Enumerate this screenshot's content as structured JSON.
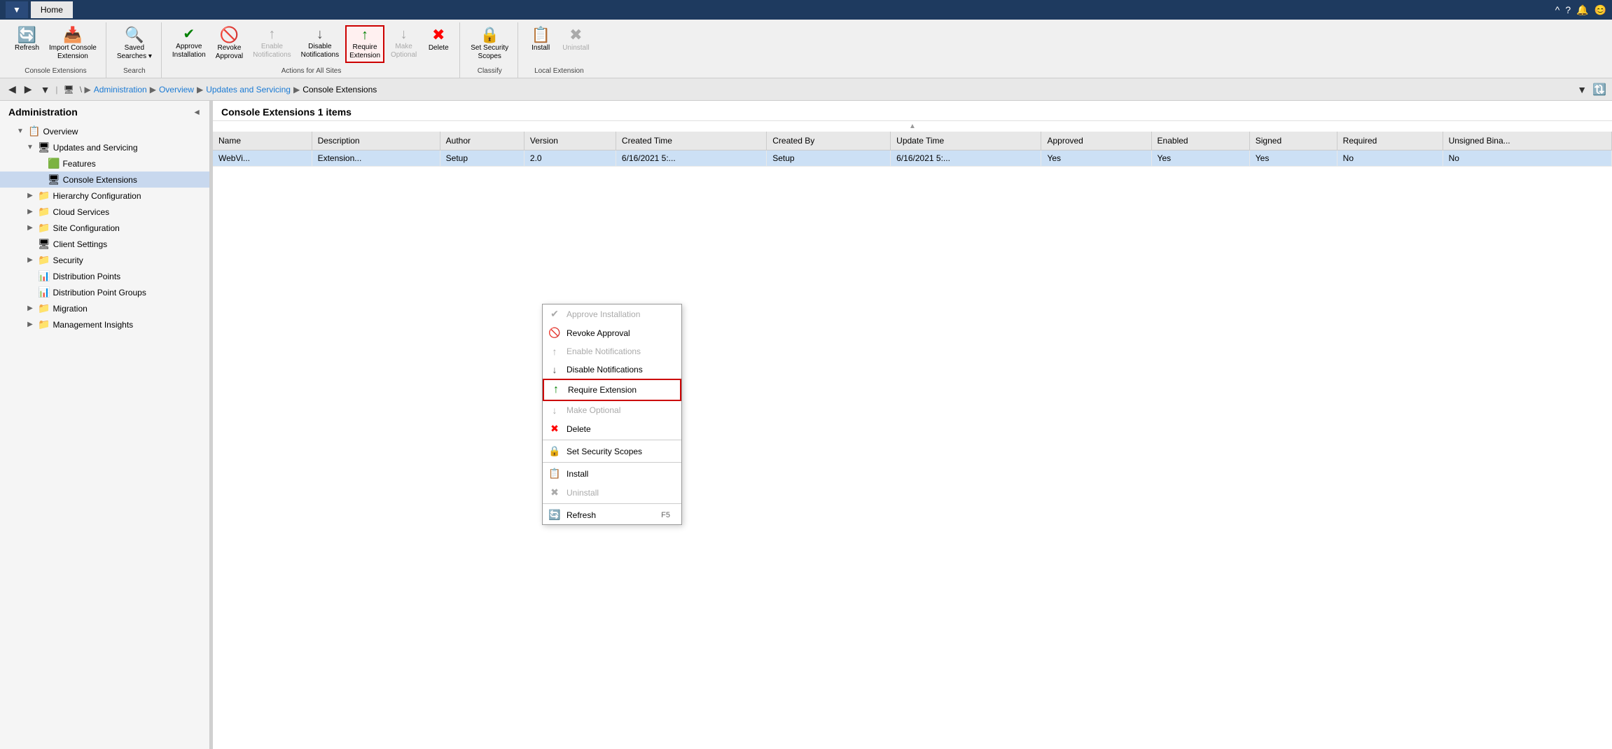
{
  "titlebar": {
    "btn_label": "▼",
    "tab_home": "Home",
    "icons": [
      "^",
      "?",
      "🔔",
      "😊"
    ]
  },
  "ribbon": {
    "groups": [
      {
        "label": "Console Extensions",
        "buttons": [
          {
            "id": "refresh",
            "label": "Refresh",
            "icon": "🔄",
            "disabled": false,
            "highlighted": false
          },
          {
            "id": "import-console-extension",
            "label": "Import Console\nExtension",
            "icon": "📥",
            "disabled": false,
            "highlighted": false
          }
        ]
      },
      {
        "label": "Search",
        "buttons": [
          {
            "id": "saved-searches",
            "label": "Saved\nSearches",
            "icon": "🔍",
            "disabled": false,
            "highlighted": false,
            "has_dropdown": true
          }
        ]
      },
      {
        "label": "Actions for All Sites",
        "buttons": [
          {
            "id": "approve-installation",
            "label": "Approve\nInstallation",
            "icon": "✔",
            "disabled": false,
            "highlighted": false,
            "icon_color": "green"
          },
          {
            "id": "revoke-approval",
            "label": "Revoke\nApproval",
            "icon": "🚫",
            "disabled": false,
            "highlighted": false
          },
          {
            "id": "enable-notifications",
            "label": "Enable\nNotifications",
            "icon": "↑",
            "disabled": false,
            "highlighted": false,
            "icon_color": "green"
          },
          {
            "id": "disable-notifications",
            "label": "Disable\nNotifications",
            "icon": "↓",
            "disabled": false,
            "highlighted": false,
            "icon_color": "#555"
          },
          {
            "id": "require-extension",
            "label": "Require\nExtension",
            "icon": "↑",
            "disabled": false,
            "highlighted": true,
            "icon_color": "green"
          },
          {
            "id": "make-optional",
            "label": "Make\nOptional",
            "icon": "↓",
            "disabled": false,
            "highlighted": false,
            "icon_color": "#aaa"
          },
          {
            "id": "delete",
            "label": "Delete",
            "icon": "✖",
            "disabled": false,
            "highlighted": false,
            "icon_color": "red"
          }
        ]
      },
      {
        "label": "Classify",
        "buttons": [
          {
            "id": "set-security-scopes",
            "label": "Set Security\nScopes",
            "icon": "🔒",
            "disabled": false,
            "highlighted": false
          }
        ]
      },
      {
        "label": "Local Extension",
        "buttons": [
          {
            "id": "install",
            "label": "Install",
            "icon": "📋",
            "disabled": false,
            "highlighted": false
          },
          {
            "id": "uninstall",
            "label": "Uninstall",
            "icon": "✖",
            "disabled": false,
            "highlighted": false,
            "icon_color": "#aaa"
          }
        ]
      }
    ]
  },
  "navbar": {
    "back": "◀",
    "forward": "▶",
    "dropdown": "▼",
    "breadcrumb": [
      "",
      "\\",
      "Administration",
      "Overview",
      "Updates and Servicing",
      "Console Extensions"
    ],
    "refresh_icon": "🔃"
  },
  "sidebar": {
    "title": "Administration",
    "items": [
      {
        "id": "overview",
        "label": "Overview",
        "indent": 1,
        "icon": "📋",
        "expander": "▲",
        "expanded": true
      },
      {
        "id": "updates-and-servicing",
        "label": "Updates and Servicing",
        "indent": 2,
        "icon": "🖥",
        "expander": "▲",
        "expanded": true
      },
      {
        "id": "features",
        "label": "Features",
        "indent": 3,
        "icon": "🟩",
        "expander": ""
      },
      {
        "id": "console-extensions",
        "label": "Console Extensions",
        "indent": 3,
        "icon": "🖥",
        "expander": "",
        "selected": true
      },
      {
        "id": "hierarchy-configuration",
        "label": "Hierarchy Configuration",
        "indent": 2,
        "icon": "📁",
        "expander": "▶"
      },
      {
        "id": "cloud-services",
        "label": "Cloud Services",
        "indent": 2,
        "icon": "📁",
        "expander": "▶"
      },
      {
        "id": "site-configuration",
        "label": "Site Configuration",
        "indent": 2,
        "icon": "📁",
        "expander": "▶"
      },
      {
        "id": "client-settings",
        "label": "Client Settings",
        "indent": 2,
        "icon": "🖥",
        "expander": ""
      },
      {
        "id": "security",
        "label": "Security",
        "indent": 2,
        "icon": "📁",
        "expander": "▶"
      },
      {
        "id": "distribution-points",
        "label": "Distribution Points",
        "indent": 2,
        "icon": "📊",
        "expander": ""
      },
      {
        "id": "distribution-point-groups",
        "label": "Distribution Point Groups",
        "indent": 2,
        "icon": "📊",
        "expander": ""
      },
      {
        "id": "migration",
        "label": "Migration",
        "indent": 2,
        "icon": "📁",
        "expander": "▶"
      },
      {
        "id": "management-insights",
        "label": "Management Insights",
        "indent": 2,
        "icon": "📁",
        "expander": "▶"
      }
    ]
  },
  "content": {
    "title": "Console Extensions",
    "item_count": "1 items",
    "columns": [
      "Name",
      "Description",
      "Author",
      "Version",
      "Created Time",
      "Created By",
      "Update Time",
      "Approved",
      "Enabled",
      "Signed",
      "Required",
      "Unsigned Bina..."
    ],
    "rows": [
      {
        "name": "WebVi...",
        "description": "Extension...",
        "author": "Setup",
        "version": "2.0",
        "created_time": "6/16/2021 5:...",
        "created_by": "Setup",
        "update_time": "6/16/2021 5:...",
        "approved": "Yes",
        "enabled": "Yes",
        "signed": "Yes",
        "required": "No",
        "unsigned_binary": "No"
      }
    ]
  },
  "context_menu": {
    "items": [
      {
        "id": "approve-installation",
        "label": "Approve Installation",
        "icon": "✔",
        "icon_color": "#aaa",
        "disabled": true,
        "separator_after": false
      },
      {
        "id": "revoke-approval",
        "label": "Revoke Approval",
        "icon": "🚫",
        "icon_color": "red",
        "disabled": false,
        "separator_after": false
      },
      {
        "id": "enable-notifications",
        "label": "Enable Notifications",
        "icon": "↑",
        "icon_color": "#aaa",
        "disabled": true,
        "separator_after": false
      },
      {
        "id": "disable-notifications",
        "label": "Disable Notifications",
        "icon": "↓",
        "icon_color": "#555",
        "disabled": false,
        "separator_after": false
      },
      {
        "id": "require-extension",
        "label": "Require Extension",
        "icon": "↑",
        "icon_color": "green",
        "disabled": false,
        "highlighted": true,
        "separator_after": false
      },
      {
        "id": "make-optional",
        "label": "Make Optional",
        "icon": "↓",
        "icon_color": "#aaa",
        "disabled": true,
        "separator_after": false
      },
      {
        "id": "delete",
        "label": "Delete",
        "icon": "✖",
        "icon_color": "red",
        "disabled": false,
        "separator_after": true
      },
      {
        "id": "set-security-scopes",
        "label": "Set Security Scopes",
        "icon": "🔒",
        "icon_color": "#555",
        "disabled": false,
        "separator_after": true
      },
      {
        "id": "install",
        "label": "Install",
        "icon": "📋",
        "icon_color": "#555",
        "disabled": false,
        "separator_after": false
      },
      {
        "id": "uninstall",
        "label": "Uninstall",
        "icon": "✖",
        "icon_color": "#aaa",
        "disabled": true,
        "separator_after": true
      },
      {
        "id": "refresh",
        "label": "Refresh",
        "icon": "🔄",
        "icon_color": "#4a8",
        "shortcut": "F5",
        "disabled": false,
        "separator_after": false
      }
    ]
  }
}
